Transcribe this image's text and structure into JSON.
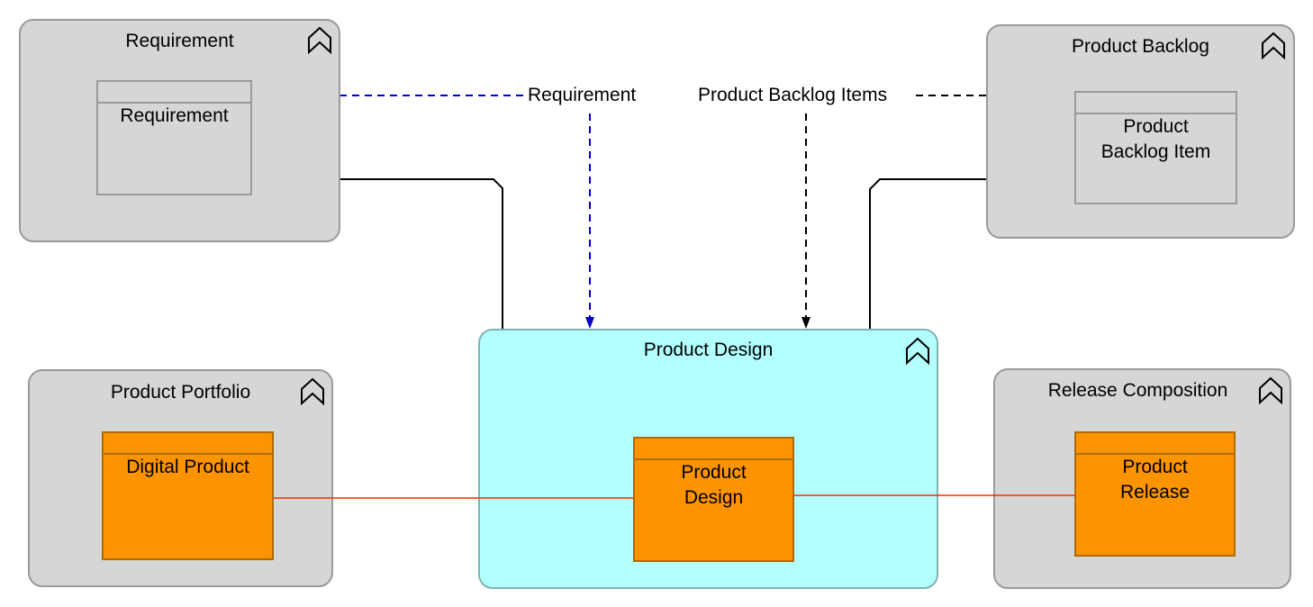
{
  "groups": {
    "requirement": {
      "title": "Requirement",
      "item": "Requirement"
    },
    "backlog": {
      "title": "Product Backlog",
      "item": "Product Backlog Item"
    },
    "design": {
      "title": "Product Design",
      "item": "Product Design"
    },
    "portfolio": {
      "title": "Product Portfolio",
      "item": "Digital Product"
    },
    "release": {
      "title": "Release Composition",
      "item": "Product Release"
    }
  },
  "edges": {
    "requirement_label": "Requirement",
    "backlog_label": "Product Backlog Items"
  },
  "colors": {
    "group_fill": "#d6d6d6",
    "active_group_fill": "#b3ffff",
    "element_fill": "#fb9400",
    "requirement_edge": "#0000cc",
    "association_edge": "#ff2a00"
  },
  "icons": {
    "collapse": "chevron-up-double-icon"
  }
}
